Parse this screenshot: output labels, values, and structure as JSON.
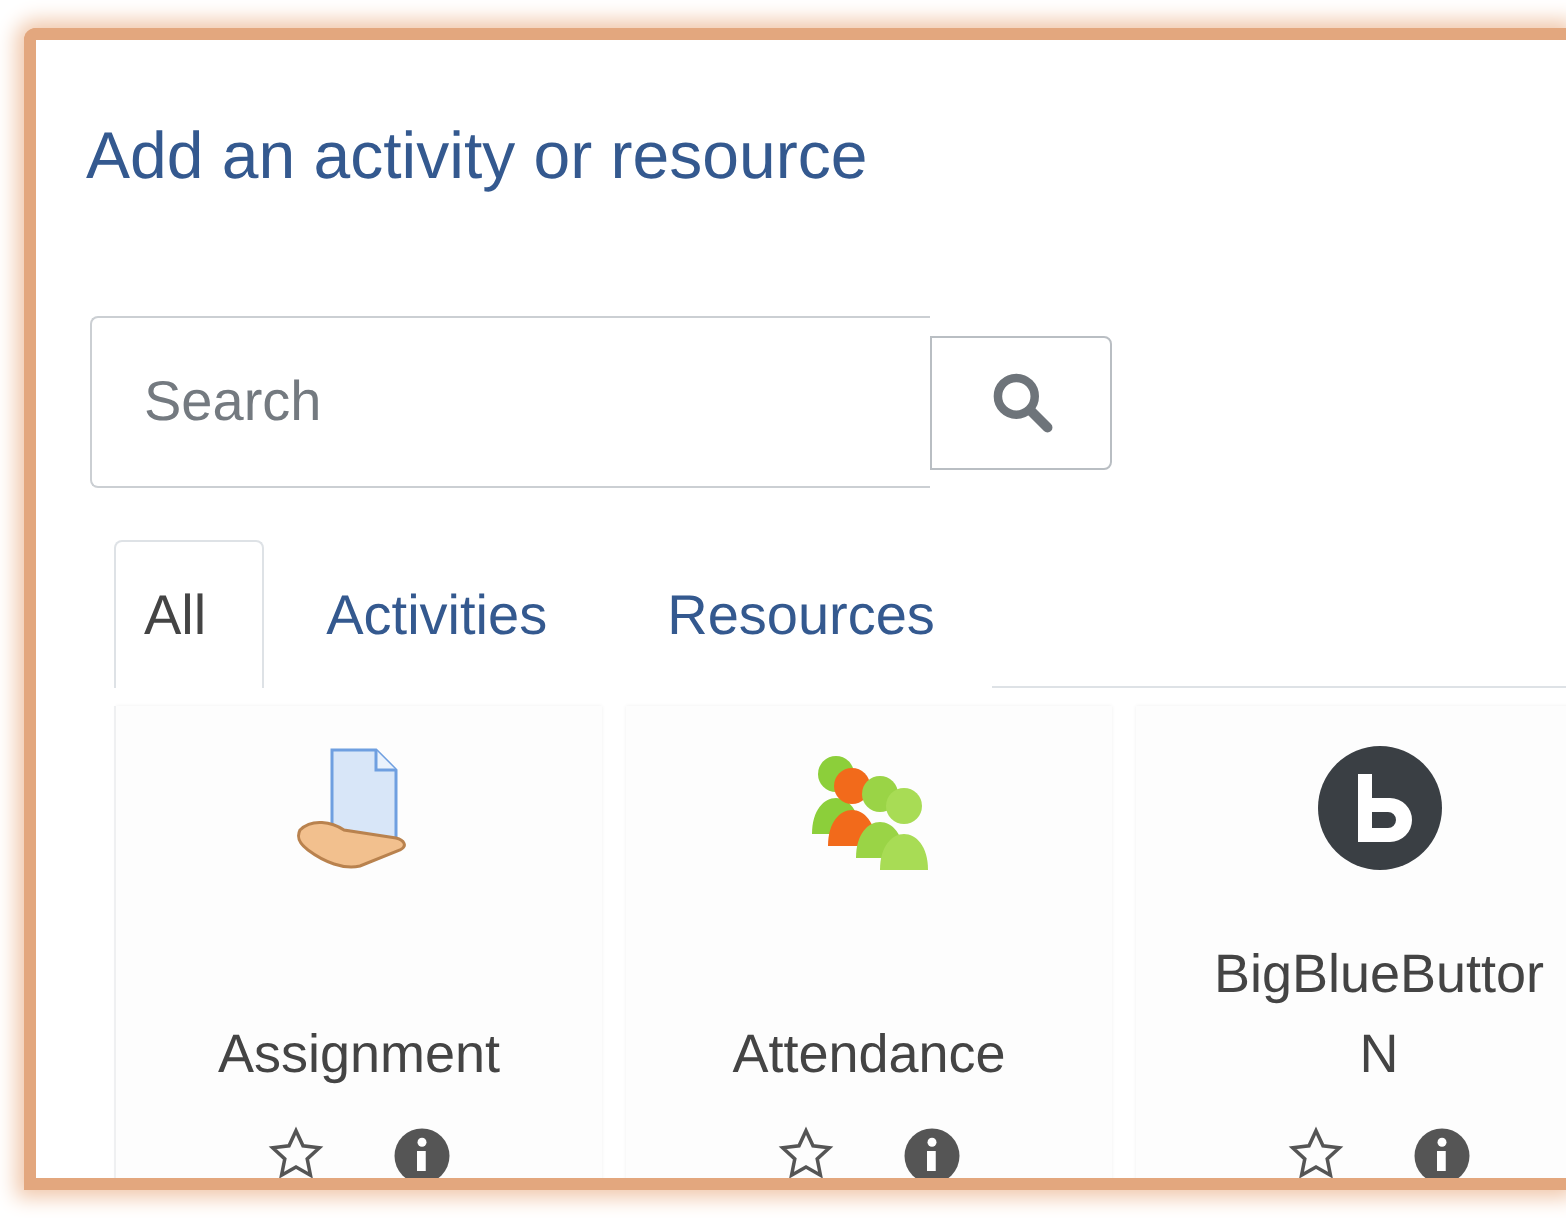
{
  "dialog": {
    "title": "Add an activity or resource"
  },
  "search": {
    "placeholder": "Search"
  },
  "tabs": [
    {
      "label": "All",
      "selected": true
    },
    {
      "label": "Activities",
      "selected": false
    },
    {
      "label": "Resources",
      "selected": false
    }
  ],
  "items": [
    {
      "kind": "assignment",
      "name_lines": [
        "Assignment"
      ]
    },
    {
      "kind": "attendance",
      "name_lines": [
        "Attendance"
      ]
    },
    {
      "kind": "bigbluebutton",
      "name_lines": [
        "BigBlueButtor",
        "N"
      ]
    }
  ]
}
